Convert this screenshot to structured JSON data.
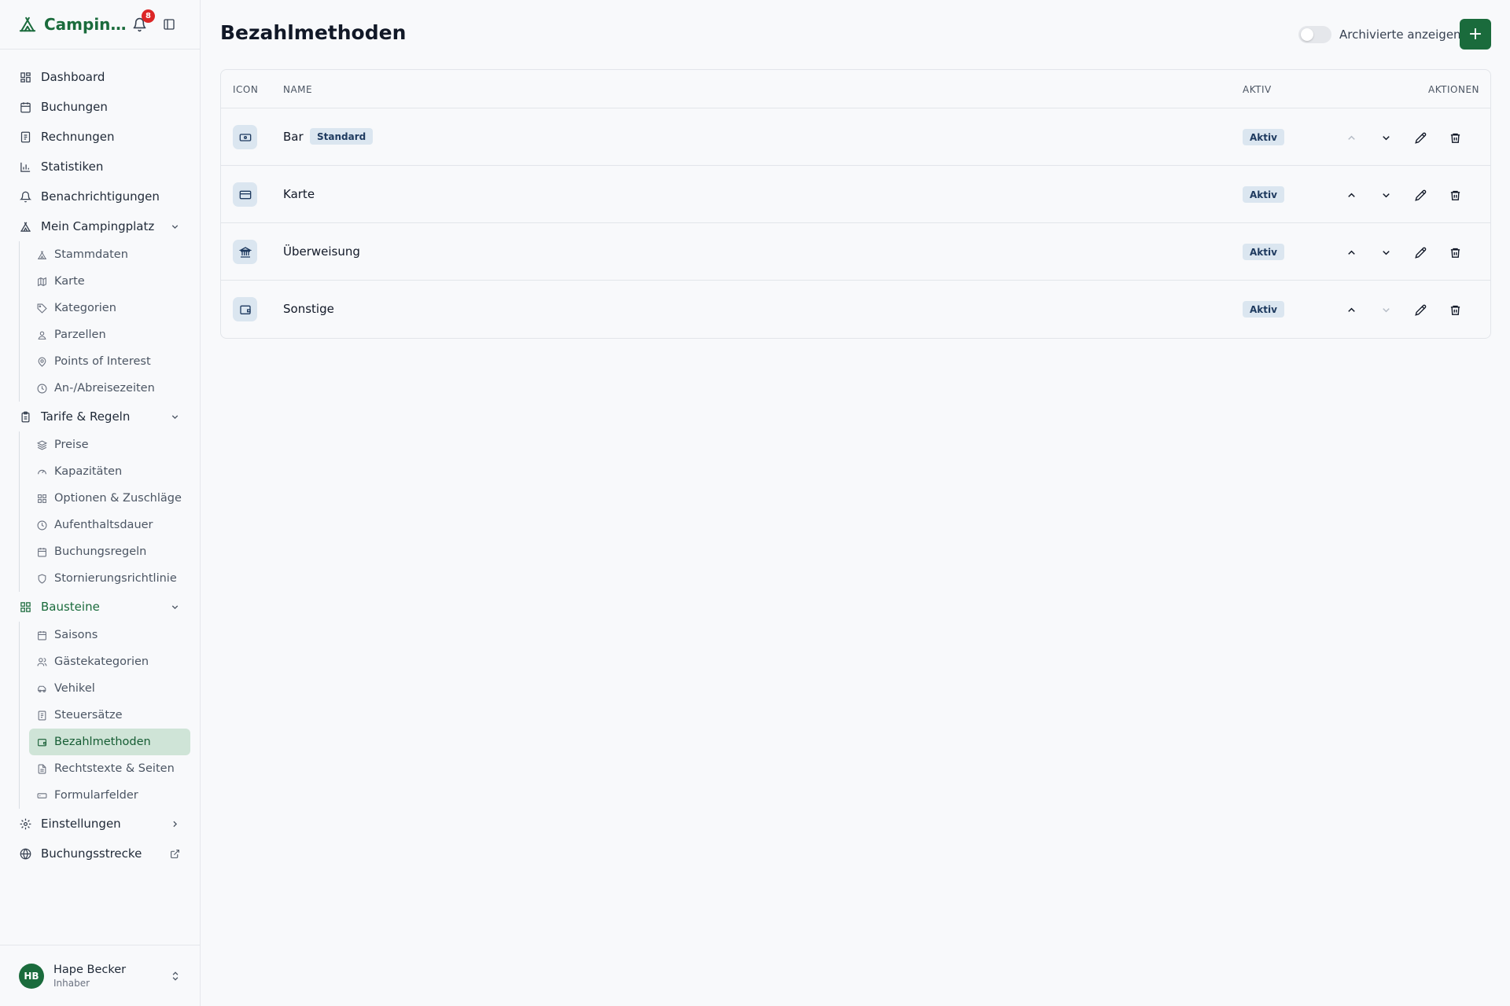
{
  "app": {
    "name": "Campingplatz",
    "notification_count": "8",
    "brand_color": "#1a6b3c"
  },
  "nav": {
    "dashboard": "Dashboard",
    "buchungen": "Buchungen",
    "rechnungen": "Rechnungen",
    "statistiken": "Statistiken",
    "benachrichtigungen": "Benachrichtigungen",
    "mein_campingplatz": {
      "label": "Mein Campingplatz",
      "items": [
        "Stammdaten",
        "Karte",
        "Kategorien",
        "Parzellen",
        "Points of Interest",
        "An-/Abreisezeiten"
      ]
    },
    "tarife": {
      "label": "Tarife & Regeln",
      "items": [
        "Preise",
        "Kapazitäten",
        "Optionen & Zuschläge",
        "Aufenthaltsdauer",
        "Buchungsregeln",
        "Stornierungsrichtlinie"
      ]
    },
    "bausteine": {
      "label": "Bausteine",
      "items": [
        "Saisons",
        "Gästekategorien",
        "Vehikel",
        "Steuersätze",
        "Bezahlmethoden",
        "Rechtstexte & Seiten",
        "Formularfelder"
      ],
      "active": "Bezahlmethoden"
    },
    "einstellungen": "Einstellungen",
    "buchungsstrecke": "Buchungsstrecke"
  },
  "user": {
    "initials": "HB",
    "name": "Hape Becker",
    "role": "Inhaber"
  },
  "page": {
    "title": "Bezahlmethoden",
    "archive_label": "Archivierte anzeigen",
    "archive_on": false,
    "add_label": "+"
  },
  "table": {
    "headers": {
      "icon": "ICON",
      "name": "NAME",
      "aktiv": "AKTIV",
      "aktionen": "AKTIONEN"
    },
    "rows": [
      {
        "icon": "banknote-icon",
        "name": "Bar",
        "badge": "Standard",
        "status": "Aktiv",
        "up_disabled": true,
        "down_disabled": false
      },
      {
        "icon": "credit-card-icon",
        "name": "Karte",
        "badge": "",
        "status": "Aktiv",
        "up_disabled": false,
        "down_disabled": false
      },
      {
        "icon": "bank-icon",
        "name": "Überweisung",
        "badge": "",
        "status": "Aktiv",
        "up_disabled": false,
        "down_disabled": false
      },
      {
        "icon": "wallet-icon",
        "name": "Sonstige",
        "badge": "",
        "status": "Aktiv",
        "up_disabled": false,
        "down_disabled": true
      }
    ]
  }
}
